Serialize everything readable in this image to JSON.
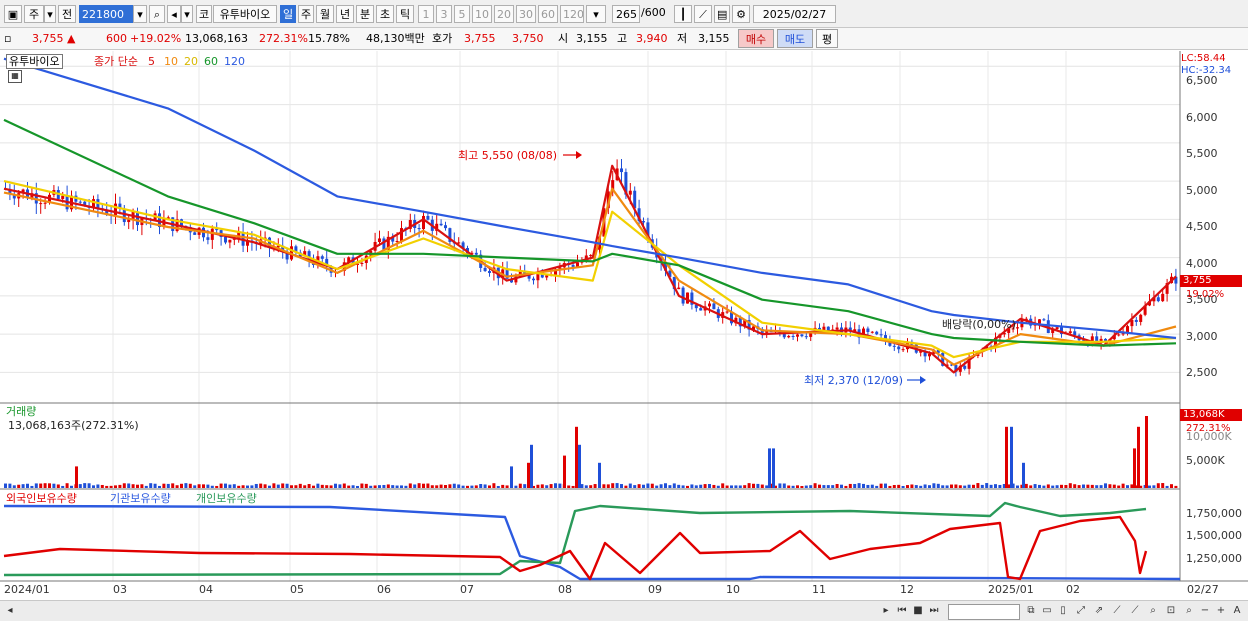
{
  "toolbar": {
    "period_label": "주",
    "mode_label": "전",
    "stock_code": "221800",
    "stock_market": "코",
    "stock_name": "유투바이오",
    "intervals": [
      "일",
      "주",
      "월",
      "년",
      "분",
      "초",
      "틱"
    ],
    "active_interval": "일",
    "multipliers": [
      "1",
      "3",
      "5",
      "10",
      "20",
      "30",
      "60",
      "120"
    ],
    "count_current": "265",
    "count_total": "/600",
    "date": "2025/02/27"
  },
  "quote": {
    "price": "3,755",
    "change_arrow": "▲",
    "change": "600",
    "change_pct": "+19.02%",
    "volume": "13,068,163",
    "volume_ratio": "272.31%",
    "turnover_rate": "15.78%",
    "trade_value": "48,130백만",
    "bid_ask_label": "호가",
    "bid_price": "3,755",
    "ask_price": "3,750",
    "open_label": "시",
    "open": "3,155",
    "high_label": "고",
    "high": "3,940",
    "low_label": "저",
    "low": "3,155",
    "buy_label": "매수",
    "sell_label": "매도",
    "eval_label": "평"
  },
  "price_panel": {
    "name_tag": "유투바이오",
    "ma_title": "종가 단순",
    "ma_periods": [
      "5",
      "10",
      "20",
      "60",
      "120"
    ],
    "lc_label": "LC:58.44",
    "hc_label": "HC:-32.34",
    "current_price_tag": "3,755",
    "current_pct_tag": "19.02%",
    "high_annotation": "최고 5,550 (08/08)",
    "low_annotation": "최저 2,370 (12/09)",
    "dividend_annotation": "배당락(0,00%)",
    "y_ticks": [
      "6,500",
      "6,000",
      "5,500",
      "5,000",
      "4,500",
      "4,000",
      "3,500",
      "3,000",
      "2,500"
    ]
  },
  "volume_panel": {
    "title": "거래량",
    "value_text": "13,068,163주(272.31%)",
    "tag_value": "13,068K",
    "tag_pct": "272.31%",
    "y_ticks": [
      "10,000K",
      "5,000K"
    ]
  },
  "holdings_panel": {
    "legend": [
      "외국인보유수량",
      "기관보유수량",
      "개인보유수량"
    ],
    "y_ticks": [
      "1,750,000",
      "1,500,000",
      "1,250,000"
    ]
  },
  "x_axis": {
    "labels": [
      "2024/01",
      "03",
      "04",
      "05",
      "06",
      "07",
      "08",
      "09",
      "10",
      "11",
      "12",
      "2025/01",
      "02"
    ],
    "end_label": "02/27"
  },
  "colors": {
    "up": "#e00000",
    "down": "#1f4fd8",
    "ma5": "#d81010",
    "ma10": "#f08a10",
    "ma20": "#f2d000",
    "ma60": "#16962a",
    "ma120": "#2c5ae0",
    "foreign": "#e00000",
    "institution": "#2c5ae0",
    "individual": "#2a9a5a"
  },
  "chart_data": {
    "type": "line",
    "title": "",
    "xlabel": "",
    "ylabel": "",
    "x": [
      "2024-01-02",
      "2024-03-01",
      "2024-04-01",
      "2024-05-01",
      "2024-06-01",
      "2024-07-01",
      "2024-08-01",
      "2024-08-08",
      "2024-09-01",
      "2024-10-01",
      "2024-11-01",
      "2024-12-01",
      "2024-12-09",
      "2025-01-02",
      "2025-02-01",
      "2025-02-27"
    ],
    "ylim": [
      2100,
      6700
    ],
    "series": [
      {
        "name": "5",
        "values": [
          4900,
          4450,
          4200,
          3850,
          4500,
          3700,
          4000,
          5200,
          3500,
          3000,
          3050,
          2750,
          2500,
          3200,
          2850,
          3755
        ]
      },
      {
        "name": "10",
        "values": [
          4850,
          4400,
          4250,
          3800,
          4350,
          3750,
          3900,
          4900,
          3700,
          3050,
          3000,
          2800,
          2600,
          3000,
          2850,
          3100
        ]
      },
      {
        "name": "20",
        "values": [
          5000,
          4500,
          4300,
          3850,
          4250,
          3850,
          3700,
          4600,
          3900,
          3150,
          3000,
          2850,
          2700,
          2900,
          2900,
          2950
        ]
      },
      {
        "name": "60",
        "values": [
          5800,
          4800,
          4450,
          4050,
          4050,
          4000,
          3950,
          4050,
          3900,
          3450,
          3300,
          3000,
          2950,
          2900,
          2850,
          2880
        ]
      },
      {
        "name": "120",
        "values": [
          6600,
          5950,
          5400,
          4800,
          4600,
          4400,
          4200,
          4150,
          4000,
          3800,
          3650,
          3300,
          3250,
          3150,
          3050,
          2950
        ]
      }
    ]
  }
}
